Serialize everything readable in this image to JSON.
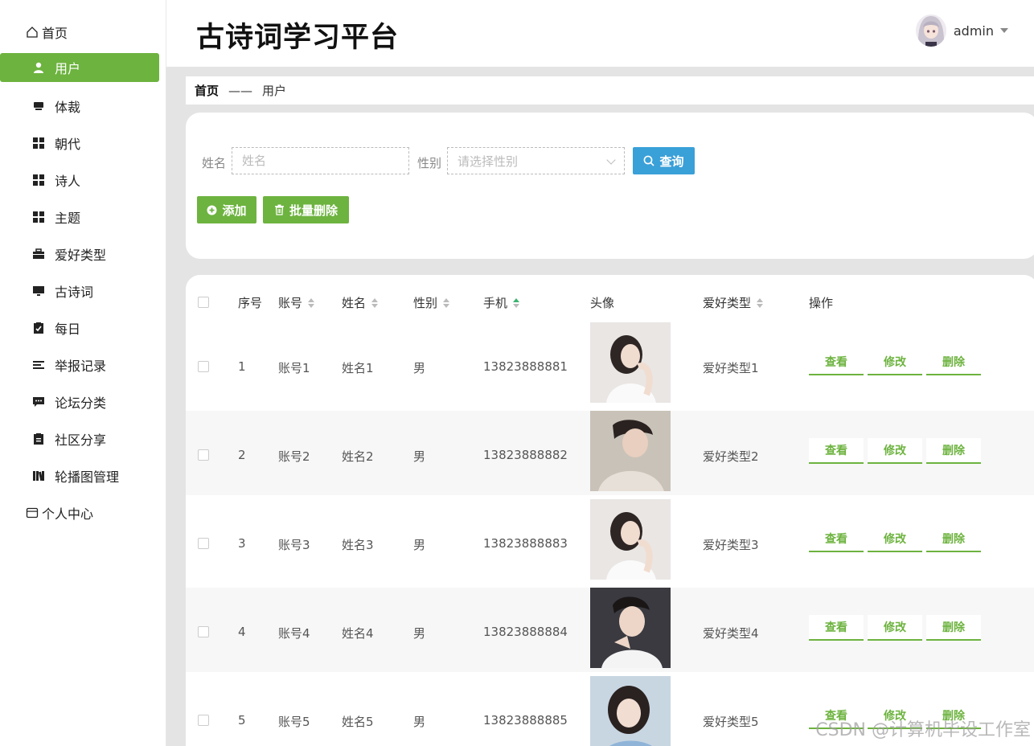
{
  "header": {
    "title": "古诗词学习平台",
    "username": "admin"
  },
  "sidebar": {
    "home": "首页",
    "items": [
      {
        "label": "用户",
        "icon": "user-icon",
        "active": true
      },
      {
        "label": "体裁",
        "icon": "tray-icon"
      },
      {
        "label": "朝代",
        "icon": "grid-icon"
      },
      {
        "label": "诗人",
        "icon": "grid-icon"
      },
      {
        "label": "主题",
        "icon": "grid-icon"
      },
      {
        "label": "爱好类型",
        "icon": "briefcase-icon"
      },
      {
        "label": "古诗词",
        "icon": "monitor-icon"
      },
      {
        "label": "每日",
        "icon": "clipboard-check-icon"
      },
      {
        "label": "举报记录",
        "icon": "list-icon"
      },
      {
        "label": "论坛分类",
        "icon": "chat-icon"
      },
      {
        "label": "社区分享",
        "icon": "document-icon"
      },
      {
        "label": "轮播图管理",
        "icon": "books-icon"
      }
    ],
    "profile": "个人中心"
  },
  "breadcrumb": {
    "home": "首页",
    "separator": "——",
    "current": "用户"
  },
  "search": {
    "name_label": "姓名",
    "name_placeholder": "姓名",
    "gender_label": "性别",
    "gender_placeholder": "请选择性别",
    "query_button": "查询",
    "add_button": "添加",
    "batch_delete_button": "批量删除"
  },
  "table": {
    "columns": [
      "序号",
      "账号",
      "姓名",
      "性别",
      "手机",
      "头像",
      "爱好类型",
      "操作"
    ],
    "actions": [
      "查看",
      "修改",
      "删除"
    ],
    "rows": [
      {
        "index": "1",
        "account": "账号1",
        "name": "姓名1",
        "gender": "男",
        "phone": "13823888881",
        "hobby": "爱好类型1"
      },
      {
        "index": "2",
        "account": "账号2",
        "name": "姓名2",
        "gender": "男",
        "phone": "13823888882",
        "hobby": "爱好类型2"
      },
      {
        "index": "3",
        "account": "账号3",
        "name": "姓名3",
        "gender": "男",
        "phone": "13823888883",
        "hobby": "爱好类型3"
      },
      {
        "index": "4",
        "account": "账号4",
        "name": "姓名4",
        "gender": "男",
        "phone": "13823888884",
        "hobby": "爱好类型4"
      },
      {
        "index": "5",
        "account": "账号5",
        "name": "姓名5",
        "gender": "男",
        "phone": "13823888885",
        "hobby": "爱好类型5"
      }
    ]
  },
  "watermark": "CSDN @计算机毕设工作室",
  "colors": {
    "accent": "#6db33f",
    "query": "#3aa0d8",
    "sort_active": "#3cb371"
  }
}
